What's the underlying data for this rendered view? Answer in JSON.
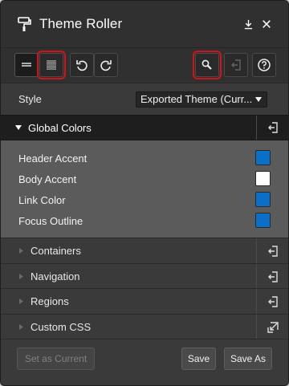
{
  "window": {
    "title": "Theme Roller",
    "icon": "paint-roller-icon",
    "controls": [
      "pin-icon",
      "close-icon"
    ]
  },
  "toolbar": {
    "buttons": [
      {
        "icon": "simple-view-icon",
        "state": "active"
      },
      {
        "icon": "detailed-view-icon",
        "state": "highlighted"
      },
      {
        "icon": "undo-icon",
        "state": "normal"
      },
      {
        "icon": "redo-icon",
        "state": "normal"
      },
      {
        "icon": "search-icon",
        "state": "highlighted"
      },
      {
        "icon": "reset-icon",
        "state": "disabled"
      },
      {
        "icon": "help-icon",
        "state": "normal"
      }
    ]
  },
  "style": {
    "label": "Style",
    "selected": "Exported Theme (Curr..."
  },
  "global_colors": {
    "label": "Global Colors",
    "expanded": true,
    "items": [
      {
        "label": "Header Accent",
        "color": "#0a6fc7"
      },
      {
        "label": "Body Accent",
        "color": "#ffffff"
      },
      {
        "label": "Link Color",
        "color": "#0a6fc7"
      },
      {
        "label": "Focus Outline",
        "color": "#0a6fc7"
      }
    ]
  },
  "sections": [
    {
      "label": "Containers",
      "action_icon": "reset-icon"
    },
    {
      "label": "Navigation",
      "action_icon": "reset-icon"
    },
    {
      "label": "Regions",
      "action_icon": "reset-icon"
    },
    {
      "label": "Custom CSS",
      "action_icon": "open-external-icon"
    }
  ],
  "footer": {
    "set_current": "Set as Current",
    "save": "Save",
    "save_as": "Save As"
  },
  "colors": {
    "accent_blue": "#0a6fc7",
    "highlight_red": "#d0131a"
  }
}
